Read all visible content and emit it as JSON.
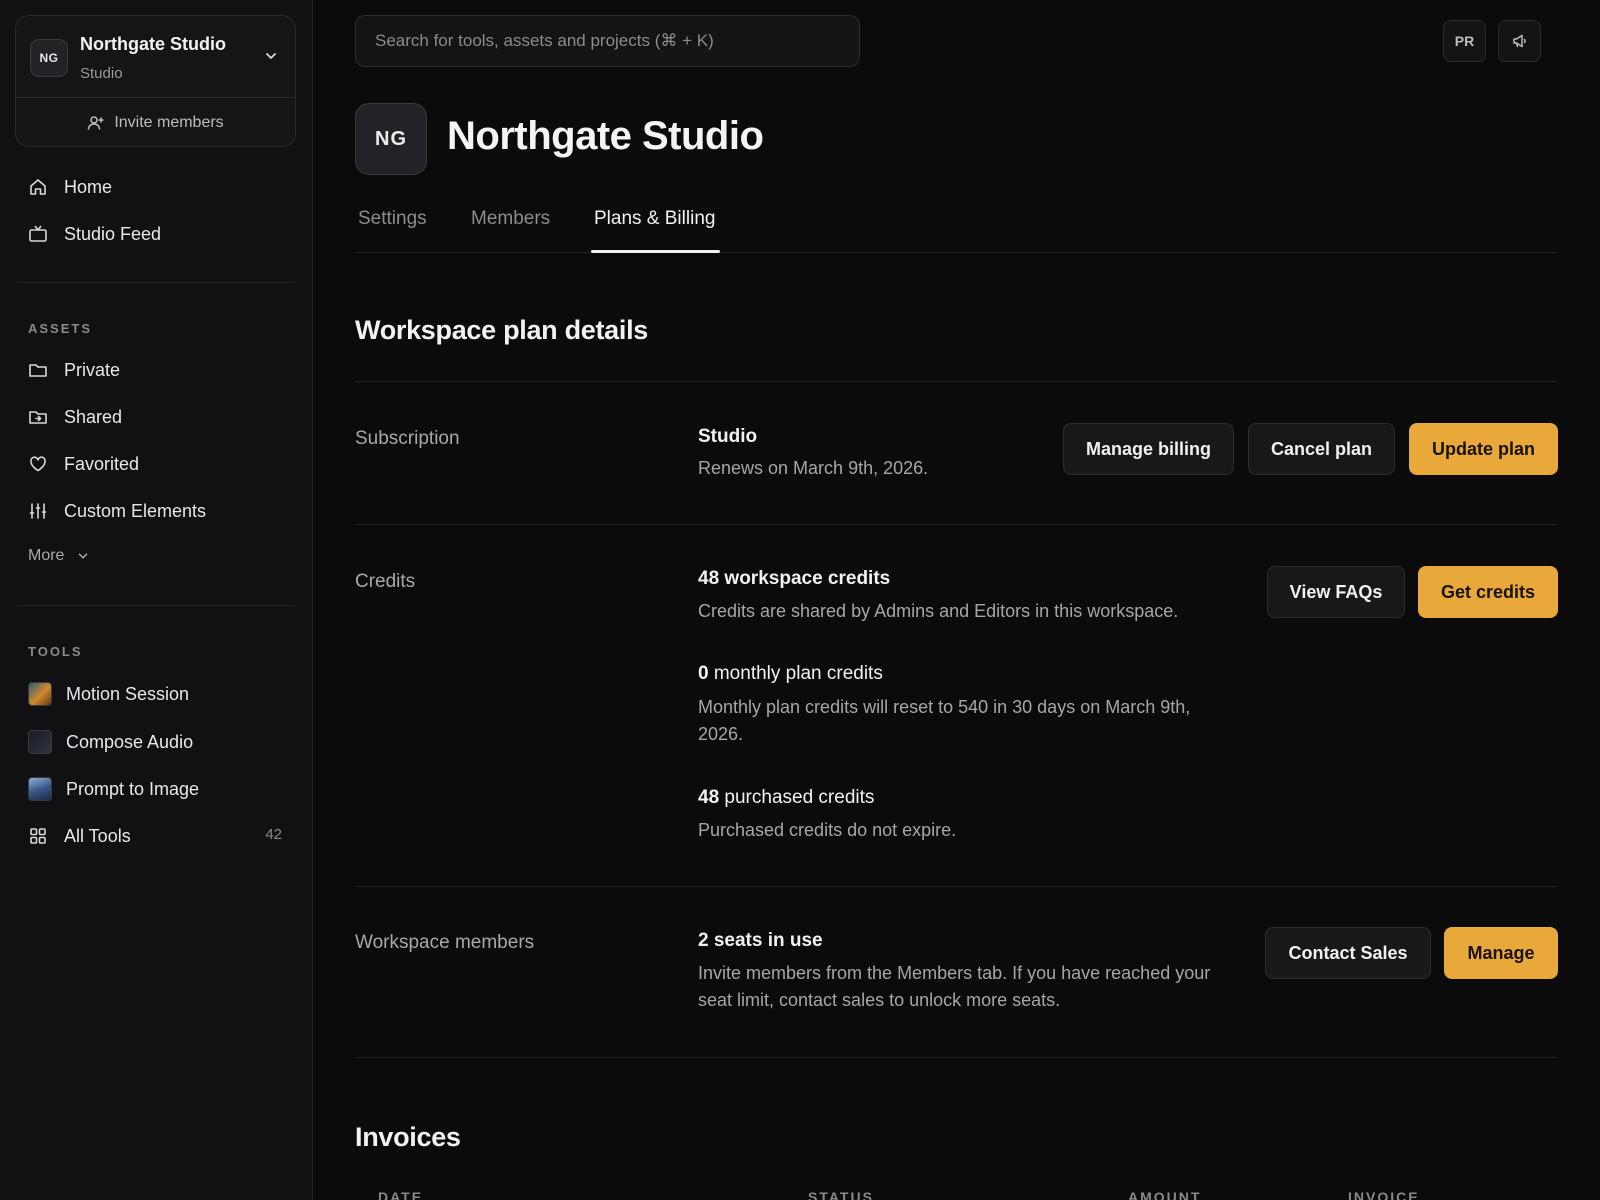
{
  "workspace": {
    "initials": "NG",
    "name": "Northgate Studio",
    "plan": "Studio",
    "invite_label": "Invite members"
  },
  "nav": {
    "home": "Home",
    "feed": "Studio Feed"
  },
  "assets": {
    "label": "ASSETS",
    "items": [
      "Private",
      "Shared",
      "Favorited",
      "Custom Elements"
    ],
    "more": "More"
  },
  "tools": {
    "label": "TOOLS",
    "items": [
      "Motion Session",
      "Compose Audio",
      "Prompt to Image",
      "All Tools"
    ],
    "all_count": "42"
  },
  "search": {
    "placeholder": "Search for tools, assets and projects (⌘ + K)"
  },
  "header": {
    "user_initials": "PR"
  },
  "page": {
    "org_initials": "NG",
    "title": "Northgate Studio",
    "tabs": [
      "Settings",
      "Members",
      "Plans & Billing"
    ]
  },
  "plan_details": {
    "heading": "Workspace plan details",
    "subscription": {
      "label": "Subscription",
      "plan_name": "Studio",
      "renews": "Renews on March 9th, 2026.",
      "buttons": [
        "Manage billing",
        "Cancel plan",
        "Update plan"
      ]
    },
    "credits": {
      "label": "Credits",
      "workspace": {
        "count": "48",
        "title": "workspace credits",
        "desc": "Credits are shared by Admins and Editors in this workspace."
      },
      "monthly": {
        "count": "0",
        "title": "monthly plan credits",
        "desc": "Monthly plan credits will reset to 540 in 30 days on March 9th, 2026."
      },
      "purchased": {
        "count": "48",
        "title": "purchased credits",
        "desc": "Purchased credits do not expire."
      },
      "buttons": [
        "View FAQs",
        "Get credits"
      ]
    },
    "members": {
      "label": "Workspace members",
      "title": "2 seats in use",
      "desc": "Invite members from the Members tab. If you have reached your seat limit, contact sales to unlock more seats.",
      "buttons": [
        "Contact Sales",
        "Manage"
      ]
    }
  },
  "invoices": {
    "heading": "Invoices",
    "columns": [
      "DATE",
      "STATUS",
      "AMOUNT",
      "INVOICE"
    ]
  },
  "colors": {
    "accent": "#e8a93a",
    "background": "#0b0b0c",
    "sidebar": "#111113"
  }
}
